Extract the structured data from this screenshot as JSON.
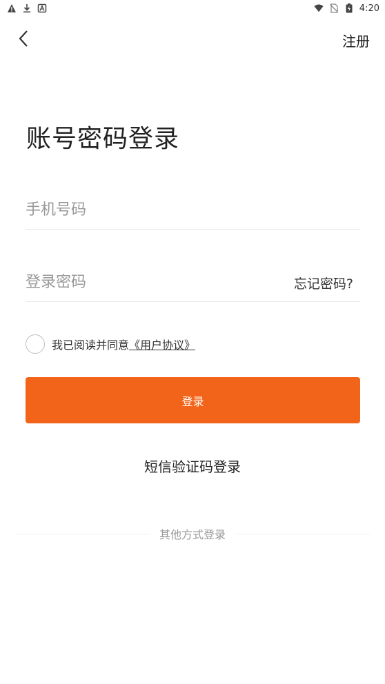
{
  "status_bar": {
    "time": "4:20",
    "left_icons": [
      "warning-icon",
      "download-icon",
      "app-notification-icon"
    ],
    "right_icons": [
      "wifi-icon",
      "no-sim-icon",
      "battery-icon"
    ]
  },
  "nav": {
    "back_icon": "chevron-left-icon",
    "register_label": "注册"
  },
  "title": "账号密码登录",
  "form": {
    "phone_placeholder": "手机号码",
    "password_placeholder": "登录密码",
    "forgot_label": "忘记密码?"
  },
  "agreement": {
    "text": "我已阅读并同意",
    "link": "《用户协议》"
  },
  "login_button_label": "登录",
  "sms_login_label": "短信验证码登录",
  "other_methods_label": "其他方式登录",
  "colors": {
    "accent": "#f26419",
    "placeholder": "#999999",
    "divider": "#e8e8e8"
  }
}
